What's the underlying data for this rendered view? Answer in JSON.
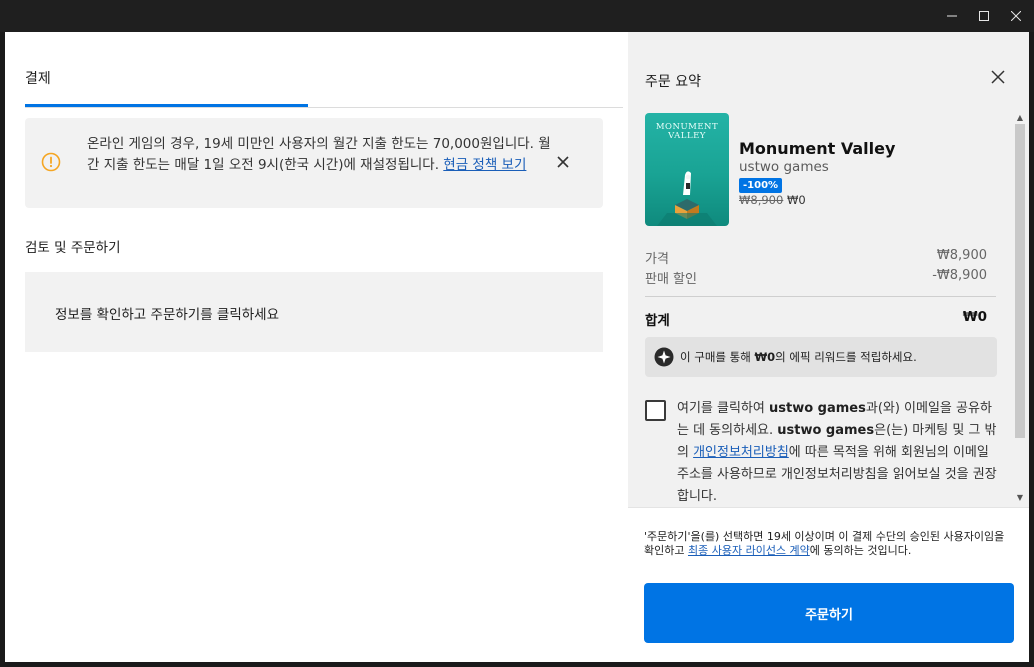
{
  "window": {
    "minimize_icon": "minimize-icon",
    "maximize_icon": "maximize-icon",
    "close_icon": "close-icon"
  },
  "checkout": {
    "tab_label": "결제",
    "notice": {
      "text": "온라인 게임의 경우, 19세 미만인 사용자의 월간 지출 한도는 70,000원입니다. 월간 지출 한도는 매달 1일 오전 9시(한국 시간)에 재설정됩니다.",
      "link": "현금 정책 보기",
      "icon": "warning-icon"
    },
    "review_section_title": "검토 및 주문하기",
    "review_prompt": "정보를 확인하고 주문하기를 클릭하세요"
  },
  "summary": {
    "title": "주문 요약",
    "product": {
      "thumbnail_title_line1": "MONUMENT",
      "thumbnail_title_line2": "VALLEY",
      "name": "Monument Valley",
      "publisher": "ustwo games",
      "discount": "-100%",
      "original_price": "₩8,900",
      "sale_price": "₩0"
    },
    "price_label": "가격",
    "price_value": "₩8,900",
    "discount_label": "판매 할인",
    "discount_value": "-₩8,900",
    "total_label": "합계",
    "total_value": "₩0",
    "reward": {
      "prefix": "이 구매를 통해 ",
      "amount": "₩0",
      "suffix": "의 에픽 리워드를 적립하세요."
    },
    "consent": {
      "part1": "여기를 클릭하여 ",
      "publisher1": "ustwo games",
      "part2": "과(와) 이메일을 공유하는 데 동의하세요. ",
      "publisher2": "ustwo games",
      "part3": "은(는) 마케팅 및 그 밖의 ",
      "link": "개인정보처리방침",
      "part4": "에 따른 목적을 위해 회원님의 이메일 주소를 사용하므로 개인정보처리방침을 읽어보실 것을 권장합니다."
    },
    "footer": {
      "part1": "'주문하기'을(를) 선택하면 19세 이상이며 이 결제 수단의 승인된 사용자이임을 확인하고 ",
      "link": "최종 사용자 라이선스 계약",
      "part2": "에 동의하는 것입니다."
    },
    "order_button": "주문하기"
  },
  "colors": {
    "accent": "#0074e4",
    "link": "#1a5eb8",
    "warning": "#f5a623",
    "panel": "#f1f1f1"
  }
}
